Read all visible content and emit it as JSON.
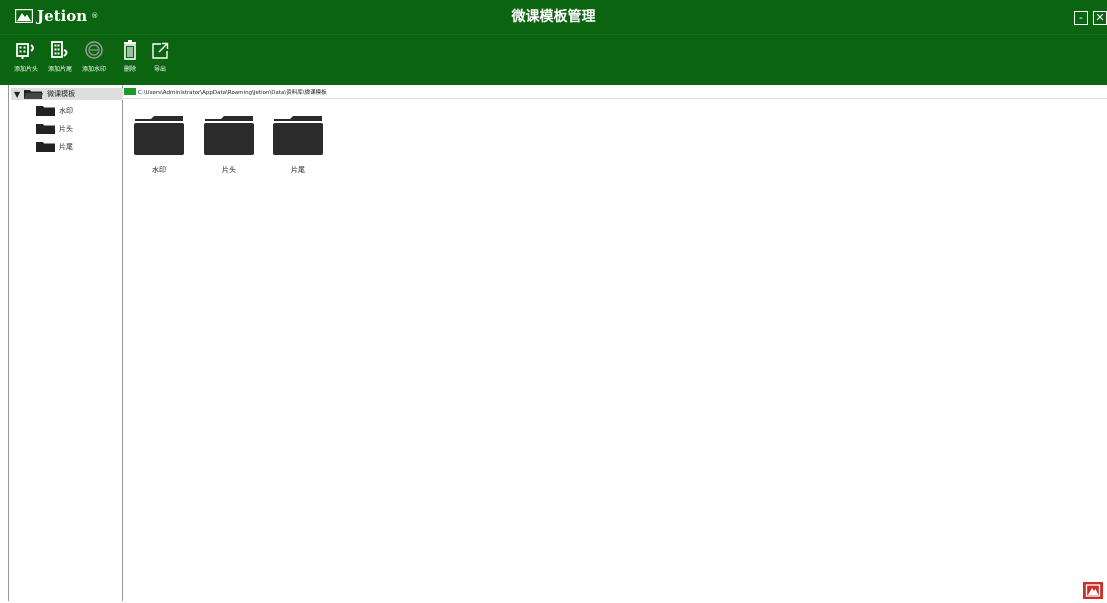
{
  "app": {
    "logo_text": "Jetion",
    "logo_reg": "®",
    "title": "微课模板管理",
    "minimize_label": "-",
    "close_label": "✕"
  },
  "toolbar": {
    "items": [
      {
        "label": "添加片头",
        "icon": "film-head-icon"
      },
      {
        "label": "添加片尾",
        "icon": "film-tail-icon"
      },
      {
        "label": "添加水印",
        "icon": "watermark-icon"
      },
      {
        "label": "删除",
        "icon": "trash-icon"
      },
      {
        "label": "导出",
        "icon": "export-icon"
      }
    ]
  },
  "tree": {
    "root_toggle": "▼",
    "root": "微课模板",
    "children": [
      "水印",
      "片头",
      "片尾"
    ]
  },
  "path": "C:\\Users\\Administrator\\AppData\\Roaming\\Jetion\\Data\\资料库\\微课模板",
  "folders": [
    "水印",
    "片头",
    "片尾"
  ],
  "colors": {
    "brand_green": "#0b6410",
    "path_green": "#1a9a2a",
    "folder_dark": "#2b2b2b",
    "corner_red": "#c9302c"
  }
}
